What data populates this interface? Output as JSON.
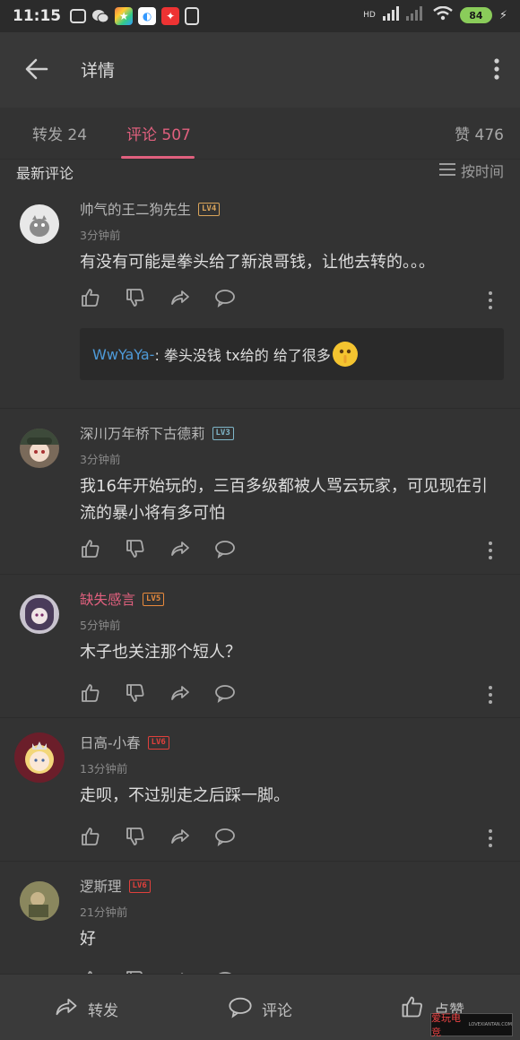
{
  "status": {
    "time": "11:15",
    "battery": "84",
    "network": "HD"
  },
  "header": {
    "title": "详情"
  },
  "tabs": [
    {
      "label": "转发 24"
    },
    {
      "label": "评论 507"
    },
    {
      "label": "赞 476"
    }
  ],
  "section": {
    "label": "最新评论",
    "sort_label": "按时间"
  },
  "comments": [
    {
      "username": "帅气的王二狗先生",
      "level": "LV4",
      "time": "3分钟前",
      "text": "有没有可能是拳头给了新浪哥钱，让他去转的。。。",
      "reply": {
        "user": "WwYaYa-",
        "text": ": 拳头没钱 tx给的 给了很多"
      }
    },
    {
      "username": "深川万年桥下古德莉",
      "level": "LV3",
      "time": "3分钟前",
      "text": "我16年开始玩的，三百多级都被人骂云玩家，可见现在引流的暴小将有多可怕"
    },
    {
      "username": "缺失感言",
      "level": "LV5",
      "time": "5分钟前",
      "text": "木子也关注那个短人？"
    },
    {
      "username": "日高-小春",
      "level": "LV6",
      "time": "13分钟前",
      "text": "走呗，不过别走之后踩一脚。"
    },
    {
      "username": "逻斯理",
      "level": "LV6",
      "time": "21分钟前",
      "text": "好"
    }
  ],
  "bottombar": {
    "repost": "转发",
    "comment": "评论",
    "like": "点赞"
  },
  "watermark": {
    "text": "爱玩电竞",
    "sub": "LOVEXIANTAN.COM"
  },
  "colors": {
    "accent": "#e0607e",
    "reply_user": "#4e9ad8",
    "background": "#333333"
  }
}
